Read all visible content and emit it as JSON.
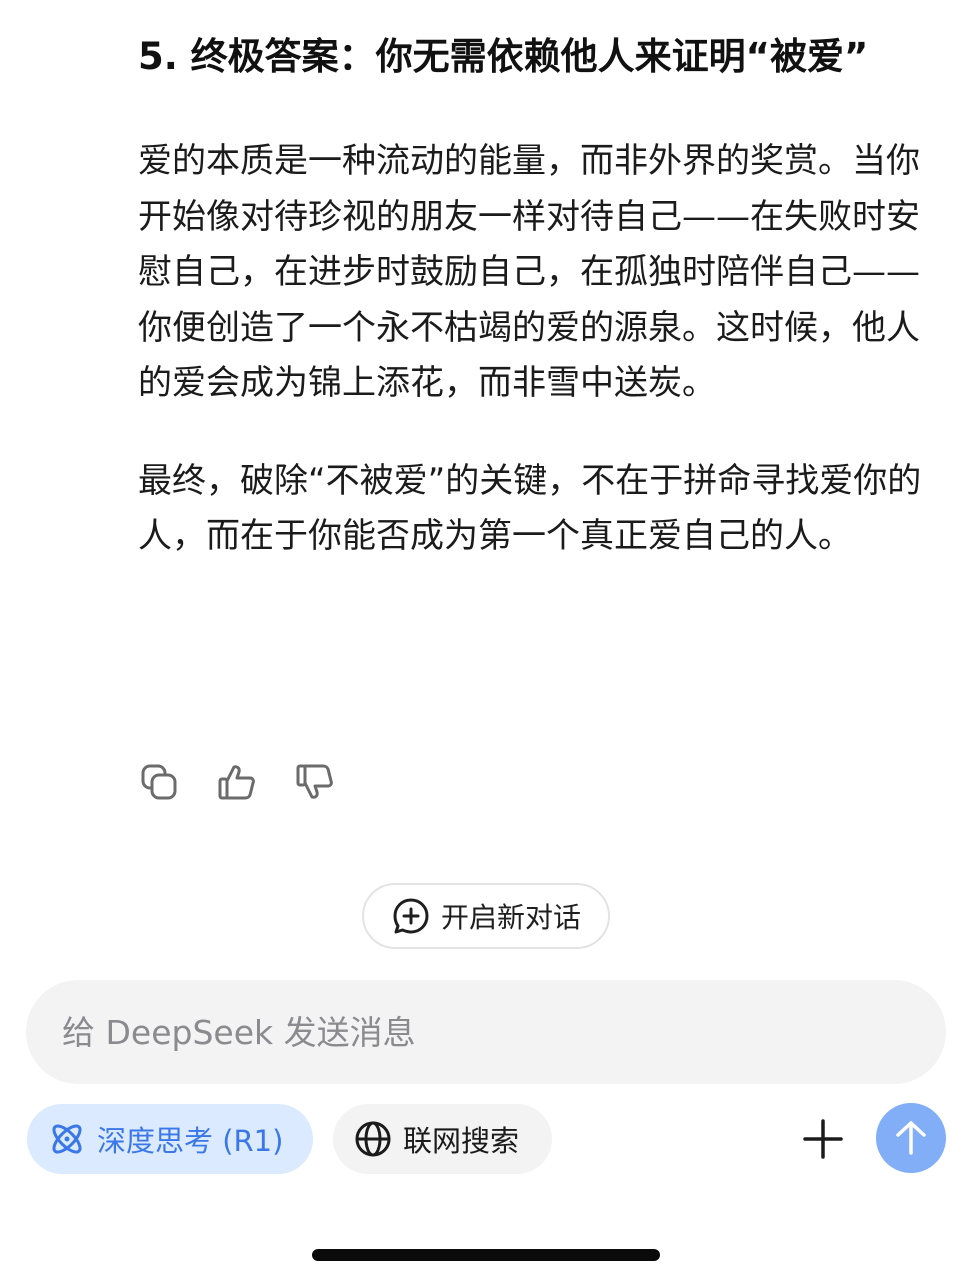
{
  "message": {
    "heading": "5. 终极答案：你无需依赖他人来证明“被爱”",
    "paragraphs": [
      "爱的本质是一种流动的能量，而非外界的奖赏。当你开始像对待珍视的朋友一样对待自己——在失败时安慰自己，在进步时鼓励自己，在孤独时陪伴自己——你便创造了一个永不枯竭的爱的源泉。这时候，他人的爱会成为锦上添花，而非雪中送炭。",
      "最终，破除“不被爱”的关键，不在于拼命寻找爱你的人，而在于你能否成为第一个真正爱自己的人。"
    ]
  },
  "actions": {
    "icons": [
      "copy-icon",
      "thumbs-up-icon",
      "thumbs-down-icon"
    ]
  },
  "new_chat": {
    "label": "开启新对话",
    "icon": "chat-plus-icon"
  },
  "composer": {
    "placeholder": "给 DeepSeek 发送消息",
    "value": ""
  },
  "toolbar": {
    "deep_think_label": "深度思考 (R1)",
    "web_search_label": "联网搜索",
    "deep_think_icon": "atom-icon",
    "web_search_icon": "globe-icon",
    "plus_icon": "plus-icon",
    "send_icon": "arrow-up-icon"
  },
  "colors": {
    "accent": "#3a77e8",
    "accent_bg": "#dbeafe",
    "send_button": "#81aef6",
    "input_bg": "#f3f3f4"
  }
}
